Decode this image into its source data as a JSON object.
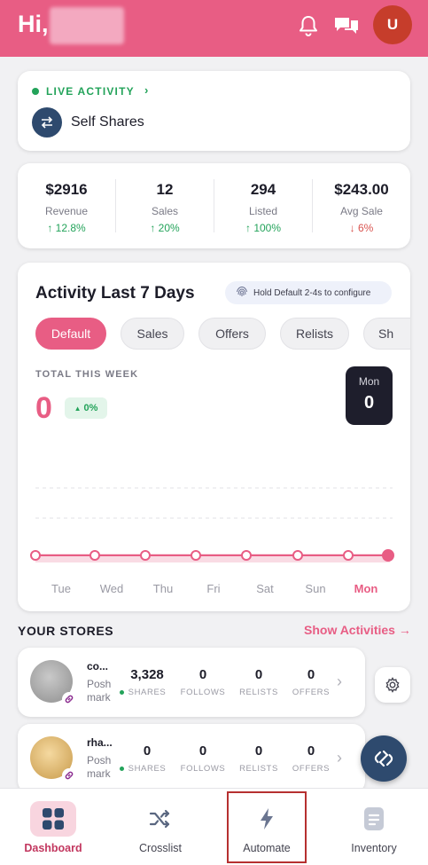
{
  "header": {
    "greeting": "Hi,",
    "avatar_initial": "U",
    "icons": [
      "bell-icon",
      "chat-icon"
    ],
    "brand_color": "#e85d84"
  },
  "live_activity": {
    "label": "LIVE ACTIVITY",
    "chevron": "›",
    "item_label": "Self Shares",
    "status_color": "#23a35a"
  },
  "stats": [
    {
      "value": "$2916",
      "label": "Revenue",
      "change": "↑ 12.8%",
      "trend": "up"
    },
    {
      "value": "12",
      "label": "Sales",
      "change": "↑ 20%",
      "trend": "up"
    },
    {
      "value": "294",
      "label": "Listed",
      "change": "↑ 100%",
      "trend": "up"
    },
    {
      "value": "$243.00",
      "label": "Avg Sale",
      "change": "↓ 6%",
      "trend": "down"
    }
  ],
  "activity": {
    "title": "Activity Last 7 Days",
    "hint": "Hold Default 2-4s to configure",
    "filters": [
      "Default",
      "Sales",
      "Offers",
      "Relists",
      "Sh"
    ],
    "active_filter": "Default",
    "total_label": "TOTAL THIS WEEK",
    "total_value": "0",
    "change": "0%",
    "selected_day": {
      "day": "Mon",
      "value": "0"
    }
  },
  "chart_data": {
    "type": "line",
    "categories": [
      "Tue",
      "Wed",
      "Thu",
      "Fri",
      "Sat",
      "Sun",
      "Mon"
    ],
    "series": [
      {
        "values": [
          0,
          0,
          0,
          0,
          0,
          0,
          0
        ]
      }
    ],
    "highlight": "Mon",
    "color": "#e85d84"
  },
  "stores": {
    "title": "YOUR STORES",
    "show_link": "Show Activities →",
    "items": [
      {
        "name": "co...",
        "platform": "Posh mark",
        "shares": "3,328",
        "follows": "0",
        "relists": "0",
        "offers": "0"
      },
      {
        "name": "rha...",
        "platform": "Posh mark",
        "shares": "0",
        "follows": "0",
        "relists": "0",
        "offers": "0"
      }
    ],
    "metric_labels": {
      "shares": "SHARES",
      "follows": "FOLLOWS",
      "relists": "RELISTS",
      "offers": "OFFERS"
    }
  },
  "nav": {
    "items": [
      {
        "label": "Dashboard",
        "icon": "grid-icon",
        "active": true
      },
      {
        "label": "Crosslist",
        "icon": "shuffle-icon",
        "active": false
      },
      {
        "label": "Automate",
        "icon": "lightning-icon",
        "active": false
      },
      {
        "label": "Inventory",
        "icon": "document-icon",
        "active": false
      }
    ]
  }
}
